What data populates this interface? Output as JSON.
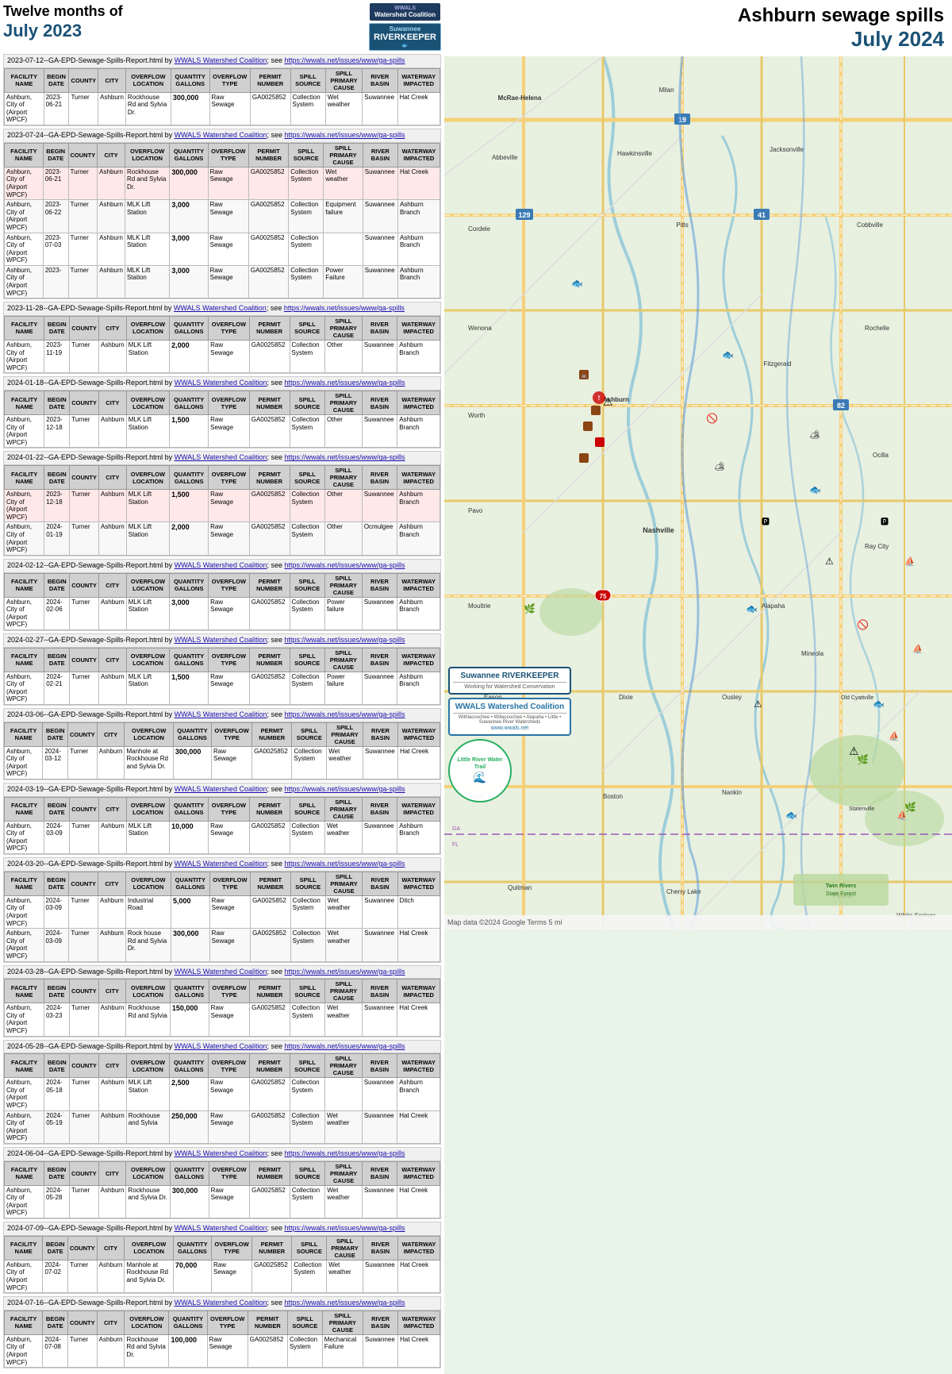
{
  "header": {
    "title_line1": "Twelve months of",
    "title_line2": "July 2023",
    "right_title_line1": "Ashburn sewage spills",
    "right_title_line2": "July 2024"
  },
  "reports": [
    {
      "id": "r1",
      "date_label": "2023-07-12--GA-EPD-Sewage-Spills-Report.html",
      "by": "WWALS Watershed Coalition",
      "see": "https://wwals.net/issues/www/ga-spills",
      "rows": [
        {
          "facility": "Ashburn, City of (Airport WPCF)",
          "begin": "2023-06-21",
          "county": "Turner",
          "city": "Ashburn",
          "location": "Rockhouse Rd and Sylvia Dr.",
          "gallons": "300,000",
          "overflow_type": "Raw Sewage",
          "permit": "GA0025852",
          "source": "Collection System",
          "primary_cause": "Wet weather",
          "river": "Suwannee",
          "waterway": "Hat Creek"
        }
      ]
    },
    {
      "id": "r2",
      "date_label": "2023-07-24--GA-EPD-Sewage-Spills-Report.html",
      "by": "WWALS Watershed Coalition",
      "see": "https://wwals.net/issues/www/ga-spills",
      "rows": [
        {
          "facility": "Ashburn, City of (Airport WPCF)",
          "begin": "2023-06-21",
          "county": "Turner",
          "city": "Ashburn",
          "location": "Rockhouse Rd and Sylvia Dr.",
          "gallons": "300,000",
          "overflow_type": "Raw Sewage",
          "permit": "GA0025852",
          "source": "Collection System",
          "primary_cause": "Wet weather",
          "river": "Suwannee",
          "waterway": "Hat Creek",
          "highlight": true
        },
        {
          "facility": "Ashburn, City of (Airport WPCF)",
          "begin": "2023-06-22",
          "county": "Turner",
          "city": "Ashburn",
          "location": "MLK Lift Station",
          "gallons": "3,000",
          "overflow_type": "Raw Sewage",
          "permit": "GA0025852",
          "source": "Collection System",
          "primary_cause": "Equipment failure",
          "river": "Suwannee",
          "waterway": "Ashburn Branch"
        },
        {
          "facility": "Ashburn, City of (Airport WPCF)",
          "begin": "2023-07-03",
          "county": "Turner",
          "city": "Ashburn",
          "location": "MLK Lift Station",
          "gallons": "3,000",
          "overflow_type": "Raw Sewage",
          "permit": "GA0025852",
          "source": "Collection System",
          "primary_cause": "",
          "river": "Suwannee",
          "waterway": "Ashburn Branch"
        },
        {
          "facility": "Ashburn, City of (Airport WPCF)",
          "begin": "2023-",
          "county": "Turner",
          "city": "Ashburn",
          "location": "MLK Lift Station",
          "gallons": "3,000",
          "overflow_type": "Raw Sewage",
          "permit": "GA0025852",
          "source": "Collection System",
          "primary_cause": "Power Failure",
          "river": "Suwannee",
          "waterway": "Ashburn Branch"
        }
      ]
    },
    {
      "id": "r3",
      "date_label": "2023-11-28--GA-EPD-Sewage-Spills-Report.html",
      "by": "WWALS Watershed Coalition",
      "see": "https://wwals.net/issues/www/ga-spills",
      "rows": [
        {
          "facility": "Ashburn, City of (Airport WPCF)",
          "begin": "2023-11-19",
          "county": "Turner",
          "city": "Ashburn",
          "location": "MLK Lift Station",
          "gallons": "2,000",
          "overflow_type": "Raw Sewage",
          "permit": "GA0025852",
          "source": "Collection System",
          "primary_cause": "Other",
          "river": "Suwannee",
          "waterway": "Ashburn Branch"
        }
      ]
    },
    {
      "id": "r4",
      "date_label": "2024-01-18--GA-EPD-Sewage-Spills-Report.html",
      "by": "WWALS Watershed Coalition",
      "see": "https://wwals.net/issues/www/ga-spills",
      "rows": [
        {
          "facility": "Ashburn, City of (Airport WPCF)",
          "begin": "2023-12-18",
          "county": "Turner",
          "city": "Ashburn",
          "location": "MLK Lift Station",
          "gallons": "1,500",
          "overflow_type": "Raw Sewage",
          "permit": "GA0025852",
          "source": "Collection System",
          "primary_cause": "Other",
          "river": "Suwannee",
          "waterway": "Ashburn Branch"
        }
      ]
    },
    {
      "id": "r5",
      "date_label": "2024-01-22--GA-EPD-Sewage-Spills-Report.html",
      "by": "WWALS Watershed Coalition",
      "see": "https://wwals.net/issues/www/ga-spills",
      "rows": [
        {
          "facility": "Ashburn, City of (Airport WPCF)",
          "begin": "2023-12-18",
          "county": "Turner",
          "city": "Ashburn",
          "location": "MLK Lift Station",
          "gallons": "1,500",
          "overflow_type": "Raw Sewage",
          "permit": "GA0025852",
          "source": "Collection System",
          "primary_cause": "Other",
          "river": "Suwannee",
          "waterway": "Ashburn Branch",
          "highlight": true
        },
        {
          "facility": "Ashburn, City of (Airport WPCF)",
          "begin": "2024-01-19",
          "county": "Turner",
          "city": "Ashburn",
          "location": "MLK Lift Station",
          "gallons": "2,000",
          "overflow_type": "Raw Sewage",
          "permit": "GA0025852",
          "source": "Collection System",
          "primary_cause": "Other",
          "river": "Ocmulgee",
          "waterway": "Ashburn Branch"
        }
      ]
    },
    {
      "id": "r6",
      "date_label": "2024-02-12--GA-EPD-Sewage-Spills-Report.html",
      "by": "WWALS Watershed Coalition",
      "see": "https://wwals.net/issues/www/ga-spills",
      "rows": [
        {
          "facility": "Ashburn, City of (Airport WPCF)",
          "begin": "2024-02-06",
          "county": "Turner",
          "city": "Ashburn",
          "location": "MLK Lift Station",
          "gallons": "3,000",
          "overflow_type": "Raw Sewage",
          "permit": "GA0025852",
          "source": "Collection System",
          "primary_cause": "Power failure",
          "river": "Suwannee",
          "waterway": "Ashburn Branch"
        }
      ]
    },
    {
      "id": "r7",
      "date_label": "2024-02-27--GA-EPD-Sewage-Spills-Report.html",
      "by": "WWALS Watershed Coalition",
      "see": "https://wwals.net/issues/www/ga-spills",
      "rows": [
        {
          "facility": "Ashburn, City of (Airport WPCF)",
          "begin": "2024-02-21",
          "county": "Turner",
          "city": "Ashburn",
          "location": "MLK Lift Station",
          "gallons": "1,500",
          "overflow_type": "Raw Sewage",
          "permit": "GA0025852",
          "source": "Collection System",
          "primary_cause": "Power failure",
          "river": "Suwannee",
          "waterway": "Ashburn Branch"
        }
      ]
    },
    {
      "id": "r8",
      "date_label": "2024-03-06--GA-EPD-Sewage-Spills-Report.html",
      "by": "WWALS Watershed Coalition",
      "see": "https://wwals.net/issues/www/ga-spills",
      "rows": [
        {
          "facility": "Ashburn, City of (Airport WPCF)",
          "begin": "2024-03-12",
          "county": "Turner",
          "city": "Ashburn",
          "location": "Manhole at Rockhouse Rd and Sylvia Dr.",
          "gallons": "300,000",
          "overflow_type": "Raw Sewage",
          "permit": "GA0025852",
          "source": "Collection System",
          "primary_cause": "Wet weather",
          "river": "Suwannee",
          "waterway": "Hat Creek"
        }
      ]
    },
    {
      "id": "r9",
      "date_label": "2024-03-19--GA-EPD-Sewage-Spills-Report.html",
      "by": "WWALS Watershed Coalition",
      "see": "https://wwals.net/issues/www/ga-spills",
      "rows": [
        {
          "facility": "Ashburn, City of (Airport WPCF)",
          "begin": "2024-03-09",
          "county": "Turner",
          "city": "Ashburn",
          "location": "MLK Lift Station",
          "gallons": "10,000",
          "overflow_type": "Raw Sewage",
          "permit": "GA0025852",
          "source": "Collection System",
          "primary_cause": "Wet weather",
          "river": "Suwannee",
          "waterway": "Ashburn Branch"
        }
      ]
    },
    {
      "id": "r10",
      "date_label": "2024-03-20--GA-EPD-Sewage-Spills-Report.html",
      "by": "WWALS Watershed Coalition",
      "see": "https://wwals.net/issues/www/ga-spills",
      "rows": [
        {
          "facility": "Ashburn, City of (Airport WPCF)",
          "begin": "2024-03-09",
          "county": "Turner",
          "city": "Ashburn",
          "location": "Industrial Road",
          "gallons": "5,000",
          "overflow_type": "Raw Sewage",
          "permit": "GA0025852",
          "source": "Collection System",
          "primary_cause": "Wet weather",
          "river": "Suwannee",
          "waterway": "Ditch"
        },
        {
          "facility": "Ashburn, City of (Airport WPCF)",
          "begin": "2024-03-09",
          "county": "Turner",
          "city": "Ashburn",
          "location": "Rock house Rd and Sylvia Dr.",
          "gallons": "300,000",
          "overflow_type": "Raw Sewage",
          "permit": "GA0025852",
          "source": "Collection System",
          "primary_cause": "Wet weather",
          "river": "Suwannee",
          "waterway": "Hat Creek"
        }
      ]
    },
    {
      "id": "r11",
      "date_label": "2024-03-28--GA-EPD-Sewage-Spills-Report.html",
      "by": "WWALS Watershed Coalition",
      "see": "https://wwals.net/issues/www/ga-spills",
      "rows": [
        {
          "facility": "Ashburn, City of (Airport WPCF)",
          "begin": "2024-03-23",
          "county": "Turner",
          "city": "Ashburn",
          "location": "Rockhouse Rd and Sylvia",
          "gallons": "150,000",
          "overflow_type": "Raw Sewage",
          "permit": "GA0025852",
          "source": "Collection System",
          "primary_cause": "Wet weather",
          "river": "Suwannee",
          "waterway": "Hat Creek"
        }
      ]
    },
    {
      "id": "r12",
      "date_label": "2024-05-28--GA-EPD-Sewage-Spills-Report.html",
      "by": "WWALS Watershed Coalition",
      "see": "https://wwals.net/issues/www/ga-spills",
      "rows": [
        {
          "facility": "Ashburn, City of (Airport WPCF)",
          "begin": "2024-05-18",
          "county": "Turner",
          "city": "Ashburn",
          "location": "MLK Lift Station",
          "gallons": "2,500",
          "overflow_type": "Raw Sewage",
          "permit": "GA0025852",
          "source": "Collection System",
          "primary_cause": "",
          "river": "Suwannee",
          "waterway": "Ashburn Branch"
        },
        {
          "facility": "Ashburn, City of (Airport WPCF)",
          "begin": "2024-05-19",
          "county": "Turner",
          "city": "Ashburn",
          "location": "Rockhouse and Sylvia",
          "gallons": "250,000",
          "overflow_type": "Raw Sewage",
          "permit": "GA0025852",
          "source": "Collection System",
          "primary_cause": "Wet weather",
          "river": "Suwannee",
          "waterway": "Hat Creek"
        }
      ]
    },
    {
      "id": "r13",
      "date_label": "2024-06-04--GA-EPD-Sewage-Spills-Report.html",
      "by": "WWALS Watershed Coalition",
      "see": "https://wwals.net/issues/www/ga-spills",
      "rows": [
        {
          "facility": "Ashburn, City of (Airport WPCF)",
          "begin": "2024-05-28",
          "county": "Turner",
          "city": "Ashburn",
          "location": "Rockhouse and Sylvia Dr.",
          "gallons": "300,000",
          "overflow_type": "Raw Sewage",
          "permit": "GA0025852",
          "source": "Collection System",
          "primary_cause": "Wet weather",
          "river": "Suwannee",
          "waterway": "Hat Creek"
        }
      ]
    },
    {
      "id": "r14",
      "date_label": "2024-07-09--GA-EPD-Sewage-Spills-Report.html",
      "by": "WWALS Watershed Coalition",
      "see": "https://wwals.net/issues/www/ga-spills",
      "rows": [
        {
          "facility": "Ashburn, City of (Airport WPCF)",
          "begin": "2024-07-02",
          "county": "Turner",
          "city": "Ashburn",
          "location": "Manhole at Rockhouse Rd and Sylvia Dr.",
          "gallons": "70,000",
          "overflow_type": "Raw Sewage",
          "permit": "GA0025852",
          "source": "Collection System",
          "primary_cause": "Wet weather",
          "river": "Suwannee",
          "waterway": "Hat Creek"
        }
      ]
    },
    {
      "id": "r15",
      "date_label": "2024-07-16--GA-EPD-Sewage-Spills-Report.html",
      "by": "WWALS Watershed Coalition",
      "see": "https://wwals.net/issues/www/ga-spills",
      "rows": [
        {
          "facility": "Ashburn, City of (Airport WPCF)",
          "begin": "2024-07-08",
          "county": "Turner",
          "city": "Ashburn",
          "location": "Rockhouse Rd and Sylvia Dr.",
          "gallons": "100,000",
          "overflow_type": "Raw Sewage",
          "permit": "GA0025852",
          "source": "Collection System",
          "primary_cause": "Mechanical Failure",
          "river": "Suwannee",
          "waterway": "Hat Creek"
        }
      ]
    }
  ],
  "table_headers": {
    "facility": "FACILITY NAME",
    "begin": "BEGIN DATE",
    "county": "COUNTY",
    "city": "CITY",
    "location": "OVERFLOW LOCATION",
    "gallons": "QUANTITY GALLONS",
    "overflow_type": "OVERFLOW TYPE",
    "permit": "PERMIT NUMBER",
    "source": "SPILL SOURCE",
    "primary_cause": "SPILL PRIMARY CAUSE",
    "river": "RIVER BASIN",
    "waterway": "WATERWAY IMPACTED"
  },
  "map": {
    "footer_text": "Map data ©2024 Google  Terms  5 mi"
  },
  "logos": {
    "wwals_text": "WWALS Watershed Coalition",
    "riverkeeper_text": "Suwannee RIVERKEEPER",
    "wwals_tagline": "Withlacoochee • Willacoochee • Alapaha • Little • Suwannee River Watersheds",
    "wwals_website": "www.wwals.net",
    "little_river": "Little River Water Trail"
  }
}
